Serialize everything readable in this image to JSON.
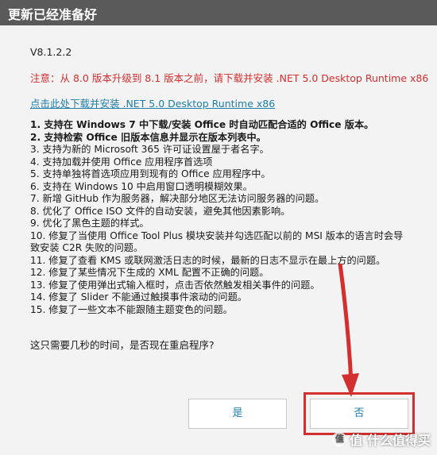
{
  "window": {
    "title": "更新已经准备好"
  },
  "version": "V8.1.2.2",
  "notice": "注意：从 8.0 版本升级到 8.1 版本之前，请下载并安装 .NET 5.0 Desktop Runtime x86",
  "download_link": "点击此处下载并安装 .NET 5.0 Desktop Runtime x86",
  "changelog": [
    "1. 支持在 Windows 7 中下载/安装 Office 时自动匹配合适的 Office 版本。",
    "2. 支持检索 Office 旧版本信息并显示在版本列表中。",
    "3. 支持为新的 Microsoft 365 许可证设置屋于者名字。",
    "4. 支持加载并使用 Office 应用程序首选项",
    "5. 支持单独将首选项应用到现有的 Office 应用程序中。",
    "6. 支持在 Windows 10 中启用窗口透明模糊效果。",
    "7. 新增 GitHub 作为服务器，解决部分地区无法访问服务器的问题。",
    "8. 优化了 Office ISO 文件的自动安装，避免其他因素影响。",
    "9. 优化了黑色主题的样式。",
    "10. 修复了当使用 Office Tool Plus 模块安装并勾选匹配以前的 MSI 版本的语言时会导",
    "致安装 C2R 失败的问题。",
    "11. 修复了查看 KMS 或联网激活日志的时候，最新的日志不显示在最上方的问题。",
    "12. 修复了某些情况下生成的 XML 配置不正确的问题。",
    "13. 修复了使用弹出式输入框时，点击否依然触发相关事件的问题。",
    "14. 修复了 Slider 不能通过触摸事件滚动的问题。",
    "15. 修复了一些文本不能跟随主题变色的问题。"
  ],
  "question": "这只需要几秒的时间，是否现在重启程序?",
  "buttons": {
    "yes": "是",
    "no": "否"
  },
  "watermark": "值 什么值得买",
  "colors": {
    "title_bar": "#5a5a5a",
    "notice": "#d32f2f",
    "link": "#1f7fa8",
    "highlight": "#d32f2f"
  }
}
